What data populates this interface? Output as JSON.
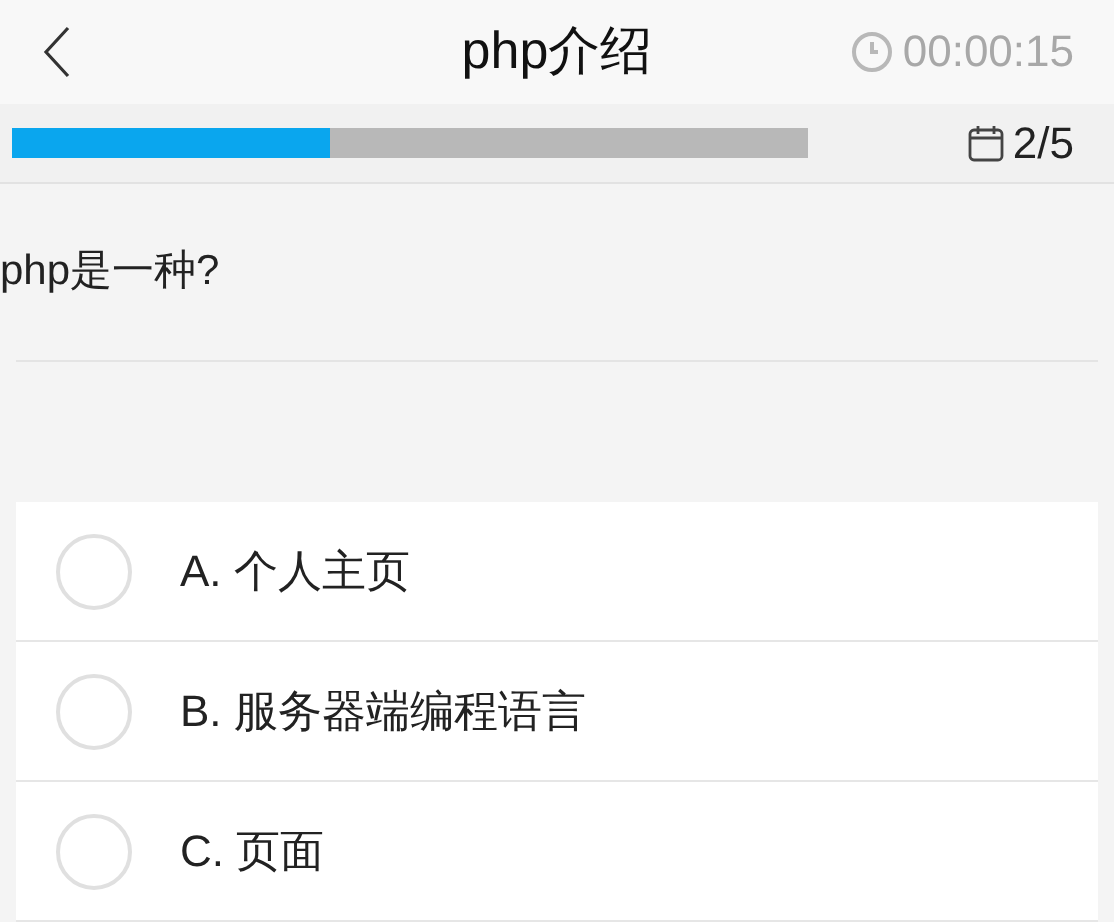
{
  "header": {
    "title": "php介绍",
    "timer": "00:00:15"
  },
  "progress": {
    "level": 0.4,
    "count": "2/5"
  },
  "question": "php是一种?",
  "options": [
    {
      "label": "A. 个人主页",
      "selected": false
    },
    {
      "label": "B. 服务器端编程语言",
      "selected": false
    },
    {
      "label": "C. 页面",
      "selected": false
    }
  ]
}
